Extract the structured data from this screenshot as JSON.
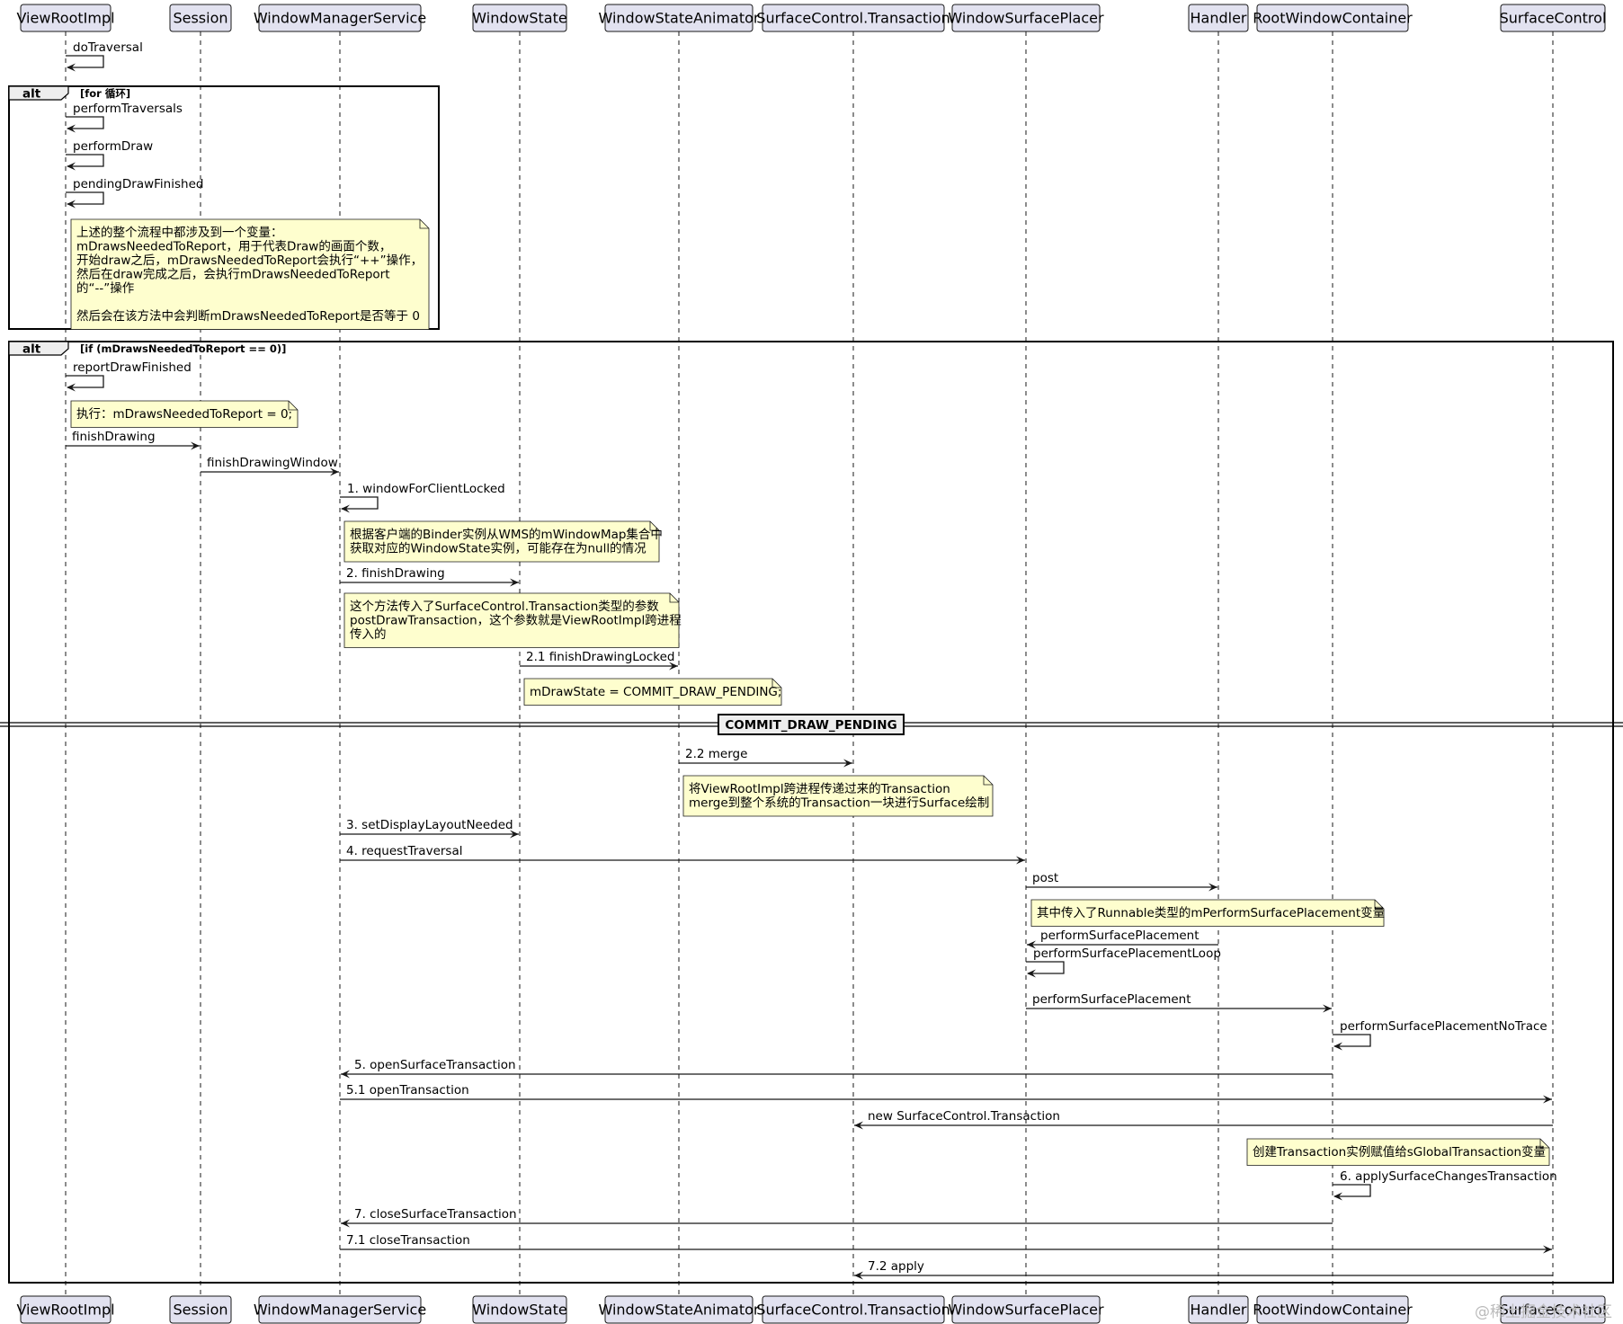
{
  "participants": [
    "ViewRootImpl",
    "Session",
    "WindowManagerService",
    "WindowState",
    "WindowStateAnimator",
    "SurfaceControl.Transaction",
    "WindowSurfacePlacer",
    "Handler",
    "RootWindowContainer",
    "SurfaceControl"
  ],
  "fragments": [
    {
      "keyword": "alt",
      "guard": "[for 循环]"
    },
    {
      "keyword": "alt",
      "guard": "[if (mDrawsNeededToReport == 0)]"
    }
  ],
  "messages": [
    {
      "from": 0,
      "to": 0,
      "label": "doTraversal"
    },
    {
      "from": 0,
      "to": 0,
      "label": "performTraversals"
    },
    {
      "from": 0,
      "to": 0,
      "label": "performDraw"
    },
    {
      "from": 0,
      "to": 0,
      "label": "pendingDrawFinished"
    },
    {
      "from": 0,
      "to": 0,
      "label": "reportDrawFinished"
    },
    {
      "from": 0,
      "to": 1,
      "label": "finishDrawing"
    },
    {
      "from": 1,
      "to": 2,
      "label": "finishDrawingWindow"
    },
    {
      "from": 2,
      "to": 2,
      "label": "1. windowForClientLocked"
    },
    {
      "from": 2,
      "to": 3,
      "label": "2. finishDrawing"
    },
    {
      "from": 3,
      "to": 4,
      "label": "2.1 finishDrawingLocked"
    },
    {
      "from": 4,
      "to": 5,
      "label": "2.2 merge"
    },
    {
      "from": 2,
      "to": 3,
      "label": "3. setDisplayLayoutNeeded"
    },
    {
      "from": 2,
      "to": 6,
      "label": "4. requestTraversal"
    },
    {
      "from": 6,
      "to": 7,
      "label": "post"
    },
    {
      "from": 7,
      "to": 6,
      "label": "performSurfacePlacement"
    },
    {
      "from": 6,
      "to": 6,
      "label": "performSurfacePlacementLoop"
    },
    {
      "from": 6,
      "to": 8,
      "label": "performSurfacePlacement"
    },
    {
      "from": 8,
      "to": 8,
      "label": "performSurfacePlacementNoTrace"
    },
    {
      "from": 8,
      "to": 2,
      "label": "5. openSurfaceTransaction"
    },
    {
      "from": 2,
      "to": 9,
      "label": "5.1 openTransaction"
    },
    {
      "from": 9,
      "to": 5,
      "label": "new SurfaceControl.Transaction"
    },
    {
      "from": 8,
      "to": 8,
      "label": "6. applySurfaceChangesTransaction"
    },
    {
      "from": 8,
      "to": 2,
      "label": "7. closeSurfaceTransaction"
    },
    {
      "from": 2,
      "to": 9,
      "label": "7.1 closeTransaction"
    },
    {
      "from": 9,
      "to": 5,
      "label": "7.2 apply"
    }
  ],
  "notes": [
    {
      "lines": [
        "上述的整个流程中都涉及到一个变量：",
        "mDrawsNeededToReport，用于代表Draw的画面个数，",
        "开始draw之后，mDrawsNeededToReport会执行“++”操作，",
        "然后在draw完成之后，会执行mDrawsNeededToReport",
        "的“--”操作",
        "",
        "然后会在该方法中会判断mDrawsNeededToReport是否等于 0"
      ]
    },
    {
      "lines": [
        "执行：mDrawsNeededToReport = 0;"
      ]
    },
    {
      "lines": [
        "根据客户端的Binder实例从WMS的mWindowMap集合中",
        "获取对应的WindowState实例，可能存在为null的情况"
      ]
    },
    {
      "lines": [
        "这个方法传入了SurfaceControl.Transaction类型的参数",
        "postDrawTransaction，这个参数就是ViewRootImpl跨进程",
        "传入的"
      ]
    },
    {
      "lines": [
        "mDrawState = COMMIT_DRAW_PENDING;"
      ]
    },
    {
      "lines": [
        "将ViewRootImpl跨进程传递过来的Transaction",
        "merge到整个系统的Transaction一块进行Surface绘制"
      ]
    },
    {
      "lines": [
        "其中传入了Runnable类型的mPerformSurfacePlacement变量"
      ]
    },
    {
      "lines": [
        "创建Transaction实例赋值给sGlobalTransaction变量"
      ]
    }
  ],
  "divider": {
    "label": "COMMIT_DRAW_PENDING"
  },
  "watermark": "@稀土掘金技术社区",
  "colors": {
    "participant_fill": "#e2e2f0",
    "note_fill": "#fefece",
    "line": "#181818"
  }
}
